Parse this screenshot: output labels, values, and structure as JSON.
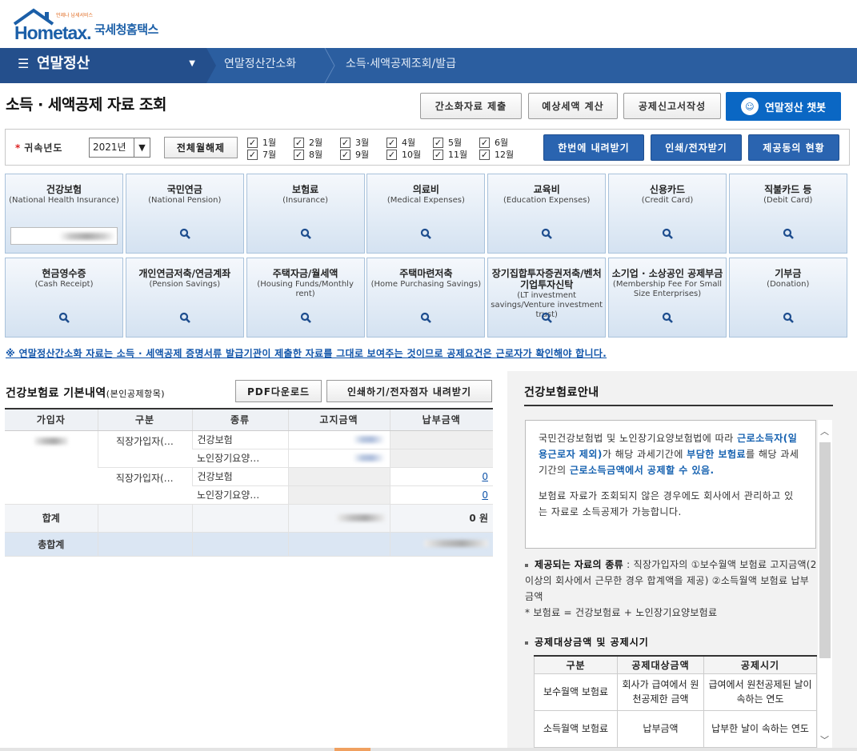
{
  "header": {
    "logo_text": "Hometax.",
    "logo_korean": "국세청홈택스",
    "logo_small": "언제나 납세서비스"
  },
  "nav": {
    "menu_label": "연말정산",
    "crumbs": [
      "연말정산간소화",
      "소득·세액공제조회/발급"
    ],
    "colors": {
      "bar": "#2b5ea0",
      "menu": "#244f8c"
    }
  },
  "page": {
    "title": "소득 · 세액공제 자료 조회",
    "buttons": [
      "간소화자료 제출",
      "예상세액 계산",
      "공제신고서작성"
    ],
    "chatbot_label": "연말정산 챗봇"
  },
  "filter": {
    "label": "귀속년도",
    "year": "2021년",
    "clear_label": "전체월해제",
    "months": [
      "1월",
      "2월",
      "3월",
      "4월",
      "5월",
      "6월",
      "7월",
      "8월",
      "9월",
      "10월",
      "11월",
      "12월"
    ],
    "months_checked": true,
    "actions": [
      "한번에 내려받기",
      "인쇄/전자받기",
      "제공동의 현황"
    ]
  },
  "tiles": [
    {
      "ko": "건강보험",
      "en": "(National Health Insurance)"
    },
    {
      "ko": "국민연금",
      "en": "(National Pension)"
    },
    {
      "ko": "보험료",
      "en": "(Insurance)"
    },
    {
      "ko": "의료비",
      "en": "(Medical Expenses)"
    },
    {
      "ko": "교육비",
      "en": "(Education Expenses)"
    },
    {
      "ko": "신용카드",
      "en": "(Credit Card)"
    },
    {
      "ko": "직불카드 등",
      "en": "(Debit Card)"
    },
    {
      "ko": "현금영수증",
      "en": "(Cash Receipt)"
    },
    {
      "ko": "개인연금저축/연금계좌",
      "en": "(Pension Savings)"
    },
    {
      "ko": "주택자금/월세액",
      "en": "(Housing Funds/Monthly rent)"
    },
    {
      "ko": "주택마련저축",
      "en": "(Home Purchasing Savings)"
    },
    {
      "ko": "장기집합투자증권저축/벤처기업투자신탁",
      "en": "(LT investment savings/Venture investment trust)"
    },
    {
      "ko": "소기업 · 소상공인 공제부금",
      "en": "(Membership Fee For Small Size Enterprises)"
    },
    {
      "ko": "기부금",
      "en": "(Donation)"
    }
  ],
  "notice": "※ 연말정산간소화 자료는 소득 · 세액공제 증명서류 발급기관이 제출한 자료를 그대로 보여주는 것이므로 공제요건은 근로자가 확인해야 합니다.",
  "section": {
    "title": "건강보험료 기본내역",
    "subtitle": "(본인공제항목)",
    "buttons": [
      "PDF다운로드",
      "인쇄하기/전자점자 내려받기"
    ]
  },
  "table": {
    "headers": [
      "가입자",
      "구분",
      "종류",
      "고지금액",
      "납부금액"
    ],
    "rows": [
      {
        "type": "직장가입자(…",
        "kind": "건강보험",
        "paid": ""
      },
      {
        "type": "",
        "kind": "노인장기요양…",
        "paid": ""
      },
      {
        "type": "직장가입자(…",
        "kind": "건강보험",
        "paid": "0"
      },
      {
        "type": "",
        "kind": "노인장기요양…",
        "paid": "0"
      }
    ],
    "sum_label": "합계",
    "sum_paid": "0 원",
    "total_label": "총합계"
  },
  "side": {
    "title": "건강보험료안내",
    "box_parts": [
      "국민건강보험법 및 노인장기요양보험법에 따라 ",
      "근로소득자(일용근로자 제외)",
      "가 해당 과세기간에 ",
      "부담한 보험료",
      "를 해당 과세기간의 ",
      "근로소득금액에서 공제할 수 있음."
    ],
    "box_p2": "보험료 자료가 조회되지 않은 경우에도 회사에서 관리하고 있는 자료로 소득공제가 가능합니다.",
    "b1_title": "제공되는 자료의 종류",
    "b1_text": " : 직장가입자의 ①보수월액 보험료 고지금액(2 이상의 회사에서 근무한 경우 합계액을 제공) ②소득월액 보험료 납부금액",
    "b1_note": "* 보험료 = 건강보험료 + 노인장기요양보험료",
    "b2_title": "공제대상금액 및 공제시기",
    "tbl_headers": [
      "구분",
      "공제대상금액",
      "공제시기"
    ],
    "tbl_rows": [
      [
        "보수월액 보험료",
        "회사가 급여에서 원천공제한 금액",
        "급여에서 원천공제된 날이 속하는 연도"
      ],
      [
        "소득월액 보험료",
        "납부금액",
        "납부한 날이 속하는 연도"
      ]
    ]
  }
}
